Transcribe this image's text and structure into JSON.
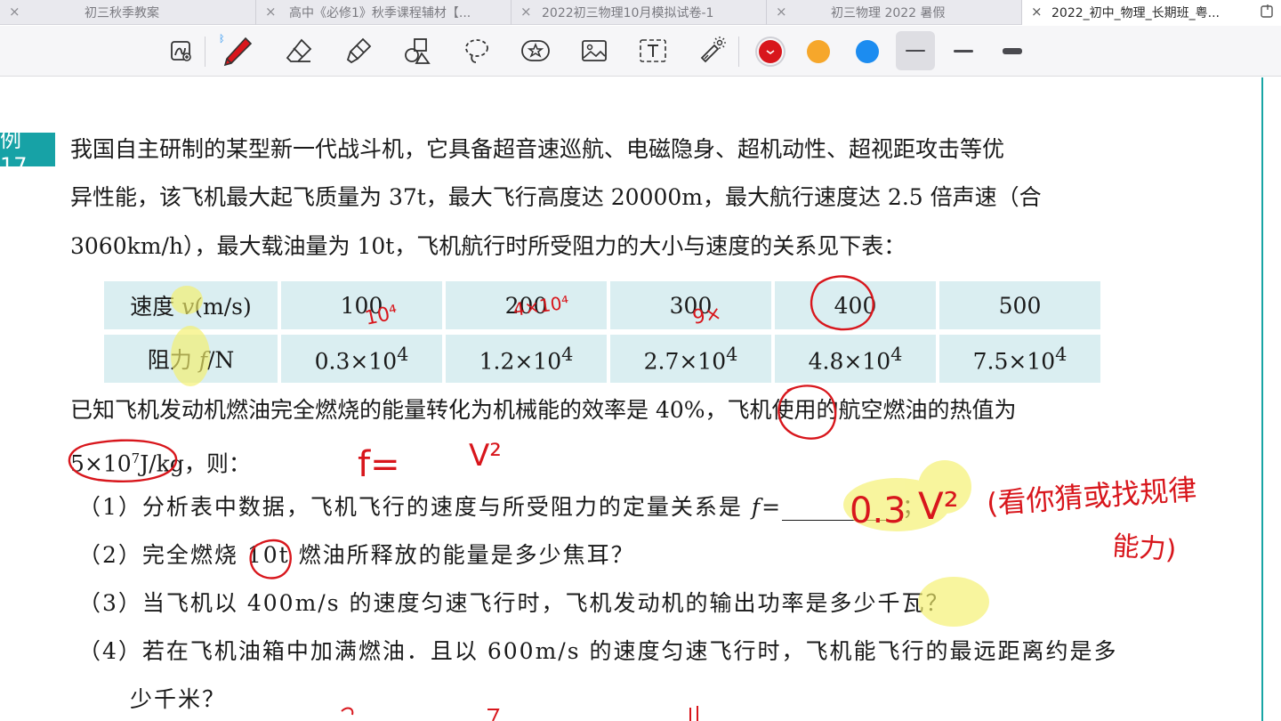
{
  "tabs": [
    {
      "label": "初三秋季教案",
      "active": false
    },
    {
      "label": "高中《必修1》秋季课程辅材【...",
      "active": false
    },
    {
      "label": "2022初三物理10月模拟试卷-1",
      "active": false
    },
    {
      "label": "初三物理 2022 暑假",
      "active": false
    },
    {
      "label": "2022_初中_物理_长期班_粤...",
      "active": true
    }
  ],
  "toolbar": {
    "tools": [
      "lasso-zoom-icon",
      "pen-icon",
      "eraser-icon",
      "highlighter-icon",
      "shapes-icon",
      "lasso-select-icon",
      "sticker-icon",
      "image-icon",
      "text-icon",
      "laser-pointer-icon"
    ],
    "colors": [
      "#d8161c",
      "#f6a72b",
      "#1c8cf0"
    ],
    "selected_color": "#d8161c"
  },
  "problem": {
    "label": "例 17",
    "line1": "我国自主研制的某型新一代战斗机，它具备超音速巡航、电磁隐身、超机动性、超视距攻击等优",
    "line2": "异性能，该飞机最大起飞质量为 37t，最大飞行高度达 20000m，最大航行速度达 2.5 倍声速（合",
    "line3": "3060km/h），最大载油量为 10t，飞机航行时所受阻力的大小与速度的关系见下表：",
    "table": {
      "row1": {
        "label_cn": "速度 ",
        "label_var": "v",
        "label_unit": "(m/s)",
        "values": [
          "100",
          "200",
          "300",
          "400",
          "500"
        ]
      },
      "row2": {
        "label_cn": "阻力 ",
        "label_var": "f",
        "label_unit": "/N",
        "values": [
          "0.3×10",
          "1.2×10",
          "2.7×10",
          "4.8×10",
          "7.5×10"
        ],
        "exponent": "4"
      }
    },
    "line4": "已知飞机发动机燃油完全燃烧的能量转化为机械能的效率是 40%，飞机使用的航空燃油的热值为",
    "line5_a": "5×10",
    "line5_exp": "7",
    "line5_b": "J/kg，则：",
    "q1_a": "（1）分析表中数据，飞机飞行的速度与所受阻力的定量关系是 ",
    "q1_var": "f",
    "q1_b": "=",
    "q1_c": "；",
    "q2": "（2）完全燃烧 10t 燃油所释放的能量是多少焦耳？",
    "q3": "（3）当飞机以 400m/s 的速度匀速飞行时，飞机发动机的输出功率是多少千瓦？",
    "q4_a": "（4）若在飞机油箱中加满燃油．且以 600m/s 的速度匀速飞行时，飞机能飞行的最远距离约是多",
    "q4_b": "少千米？"
  },
  "annotations": {
    "above_100": "10⁴",
    "above_200": "4×10⁴",
    "above_300": "9×",
    "formula_f": "f=",
    "formula_v": "V²",
    "answer_a": "0.3",
    "answer_b": "V²",
    "comment_1": "(看你猜或找规律",
    "comment_2": "能力)"
  }
}
